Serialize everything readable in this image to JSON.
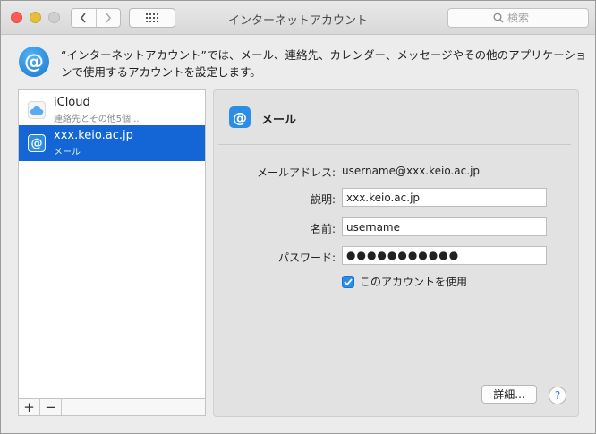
{
  "window": {
    "title": "インターネットアカウント",
    "search_placeholder": "検索"
  },
  "header": {
    "description": "“インターネットアカウント”では、メール、連絡先、カレンダー、メッセージやその他のアプリケーションで使用するアカウントを設定します。"
  },
  "accounts": [
    {
      "name": "iCloud",
      "sub": "連絡先とその他5個...",
      "icon": "icloud-icon"
    },
    {
      "name": "xxx.keio.ac.jp",
      "sub": "メール",
      "icon": "mail-icon",
      "selected": true
    }
  ],
  "list_toolbar": {
    "add": "+",
    "remove": "−"
  },
  "detail": {
    "title": "メール",
    "email_label": "メールアドレス:",
    "email_value": "username@xxx.keio.ac.jp",
    "description_label": "説明:",
    "description_value": "xxx.keio.ac.jp",
    "name_label": "名前:",
    "name_value": "username",
    "password_label": "パスワード:",
    "password_mask": "●●●●●●●●●●●",
    "use_account_label": "このアカウントを使用",
    "use_account_checked": true,
    "details_button": "詳細...",
    "help_button": "?"
  },
  "colors": {
    "selection": "#1466d6",
    "accent": "#2b8de6",
    "close": "#fc5b57",
    "minimize": "#e5bf3c"
  }
}
